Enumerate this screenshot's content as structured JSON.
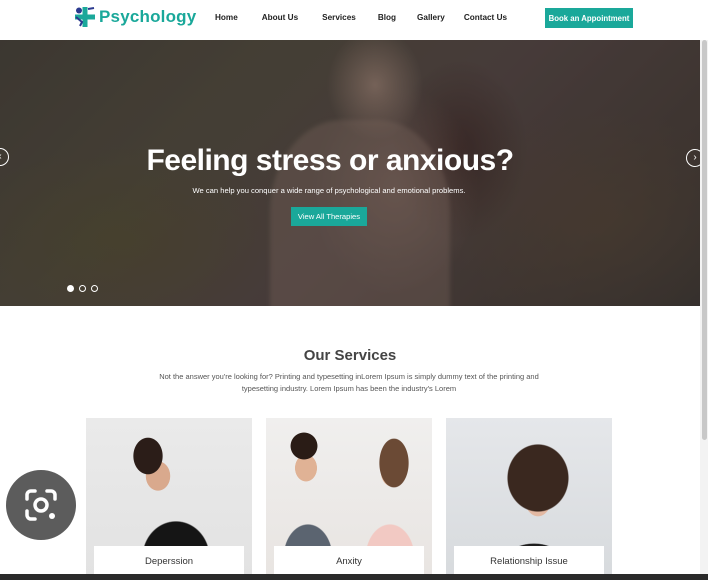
{
  "header": {
    "logo_text": "Psychology",
    "nav": [
      "Home",
      "About Us",
      "Services",
      "Blog",
      "Gallery",
      "Contact Us"
    ],
    "cta_label": "Book an Appointment"
  },
  "hero": {
    "title": "Feeling stress or anxious?",
    "subtitle": "We can help you conquer a wide range of psychological and emotional problems.",
    "button_label": "View All Therapies",
    "slides": 3,
    "active_slide": 1,
    "prev_icon": "chevron-left-icon",
    "next_icon": "chevron-right-icon"
  },
  "services": {
    "title": "Our Services",
    "description": "Not the answer you're looking for? Printing and typesetting inLorem Ipsum is simply dummy text of the printing and typesetting industry. Lorem Ipsum has been the industry's Lorem",
    "cards": [
      {
        "label": "Deperssion"
      },
      {
        "label": "Anxity"
      },
      {
        "label": "Relationship Issue"
      }
    ]
  },
  "overlay": {
    "icon": "google-lens-icon"
  },
  "colors": {
    "accent": "#1aa89a",
    "text_dark": "#222222",
    "heading": "#444444"
  }
}
